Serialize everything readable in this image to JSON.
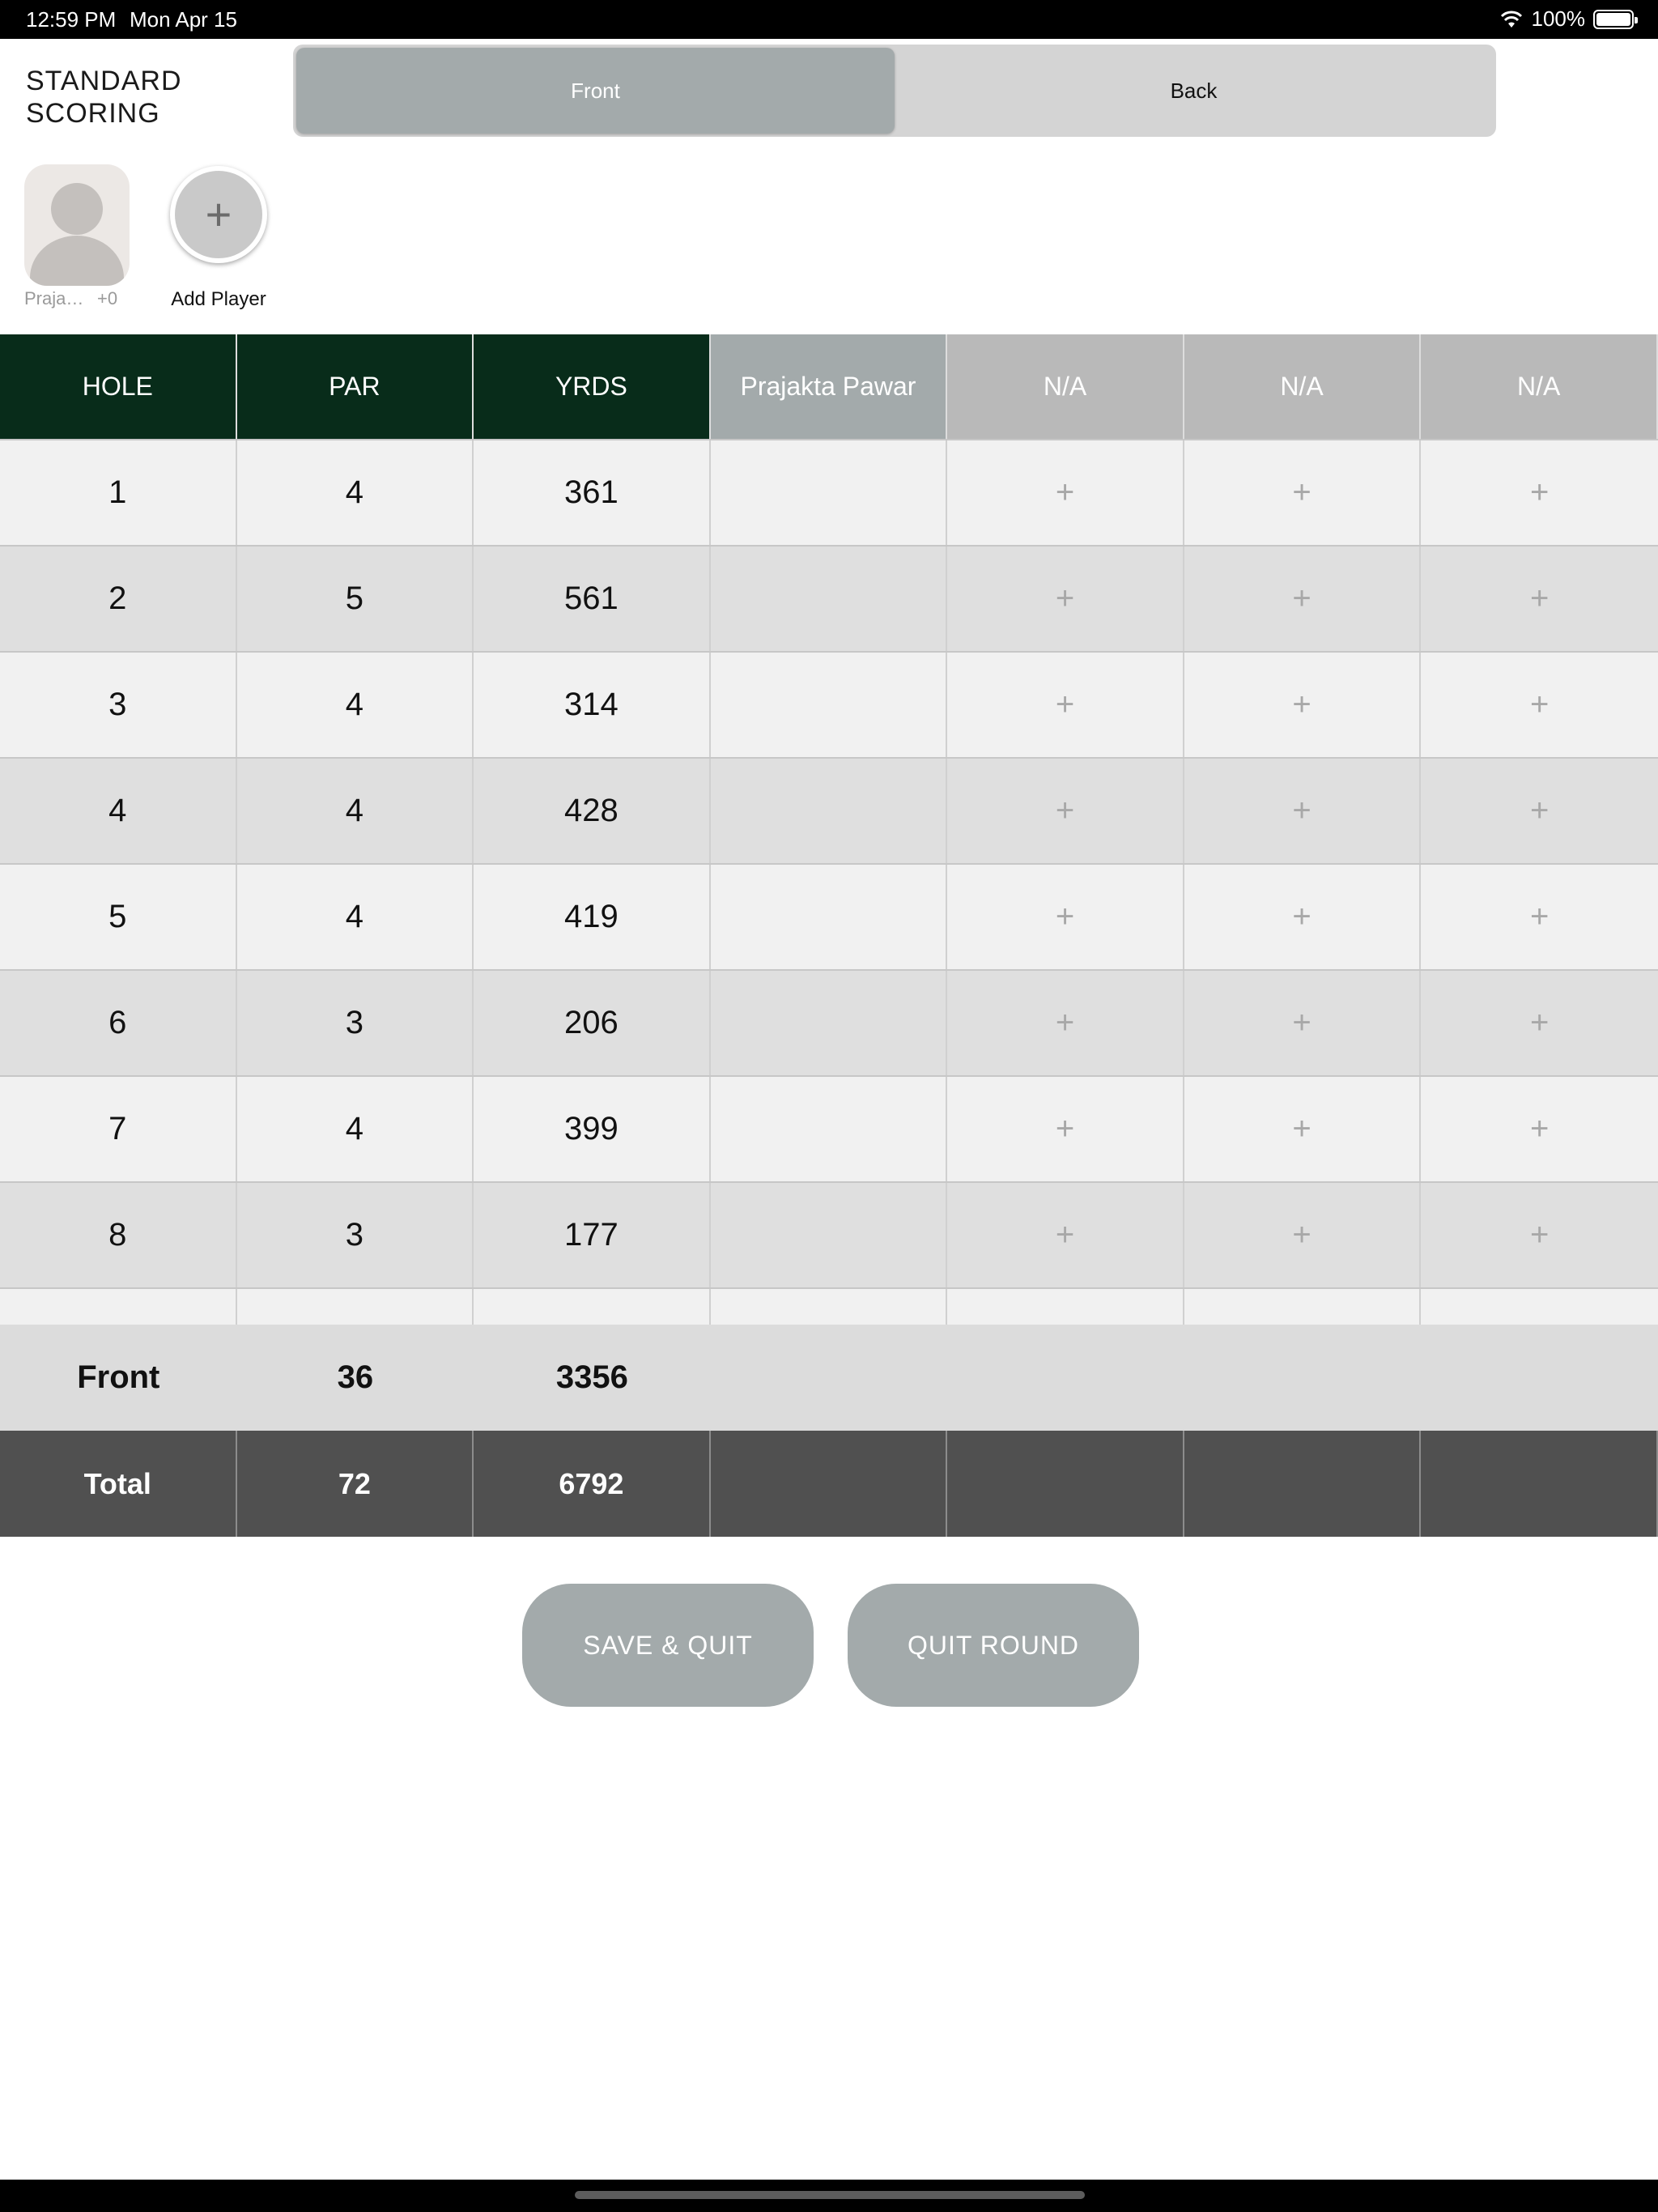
{
  "status_bar": {
    "time": "12:59 PM",
    "date": "Mon Apr 15",
    "battery": "100%"
  },
  "header": {
    "title": "STANDARD SCORING",
    "tabs": [
      {
        "label": "Front",
        "active": true
      },
      {
        "label": "Back",
        "active": false
      }
    ]
  },
  "players": {
    "current": {
      "name": "Prajakt...",
      "handicap": "+0"
    },
    "add_icon": "+",
    "add_label": "Add Player"
  },
  "table": {
    "headers": [
      "HOLE",
      "PAR",
      "YRDS",
      "Prajakta Pawar",
      "N/A",
      "N/A",
      "N/A"
    ],
    "rows": [
      {
        "hole": "1",
        "par": "4",
        "yards": "361"
      },
      {
        "hole": "2",
        "par": "5",
        "yards": "561"
      },
      {
        "hole": "3",
        "par": "4",
        "yards": "314"
      },
      {
        "hole": "4",
        "par": "4",
        "yards": "428"
      },
      {
        "hole": "5",
        "par": "4",
        "yards": "419"
      },
      {
        "hole": "6",
        "par": "3",
        "yards": "206"
      },
      {
        "hole": "7",
        "par": "4",
        "yards": "399"
      },
      {
        "hole": "8",
        "par": "3",
        "yards": "177"
      }
    ],
    "add_score_symbol": "+",
    "front": {
      "label": "Front",
      "par": "36",
      "yards": "3356"
    },
    "total": {
      "label": "Total",
      "par": "72",
      "yards": "6792"
    }
  },
  "buttons": {
    "save_quit": "SAVE & QUIT",
    "quit_round": "QUIT ROUND"
  },
  "colors": {
    "header_green": "#082c1a",
    "accent_gray": "#a3aaab",
    "total_row": "#505050"
  }
}
